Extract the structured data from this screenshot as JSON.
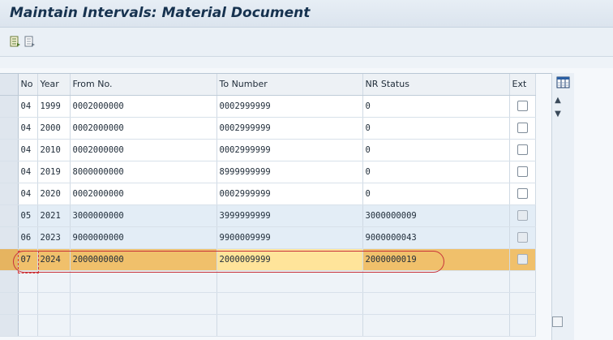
{
  "title": "Maintain Intervals: Material Document",
  "toolbar": {
    "buttons": [
      {
        "icon": "select-all-icon"
      },
      {
        "icon": "deselect-all-icon"
      }
    ]
  },
  "table": {
    "headers": {
      "no": "No",
      "year": "Year",
      "from": "From No.",
      "to": "To Number",
      "status": "NR Status",
      "ext": "Ext"
    },
    "rows": [
      {
        "no": "04",
        "year": "1999",
        "from": "0002000000",
        "to": "0002999999",
        "status": "0"
      },
      {
        "no": "04",
        "year": "2000",
        "from": "0002000000",
        "to": "0002999999",
        "status": "0"
      },
      {
        "no": "04",
        "year": "2010",
        "from": "0002000000",
        "to": "0002999999",
        "status": "0"
      },
      {
        "no": "04",
        "year": "2019",
        "from": "8000000000",
        "to": "8999999999",
        "status": "0"
      },
      {
        "no": "04",
        "year": "2020",
        "from": "0002000000",
        "to": "0002999999",
        "status": "0"
      },
      {
        "no": "05",
        "year": "2021",
        "from": "3000000000",
        "to": "3999999999",
        "status": "3000000009"
      },
      {
        "no": "06",
        "year": "2023",
        "from": "9000000000",
        "to": "9900009999",
        "status": "9000000043"
      },
      {
        "no": "07",
        "year": "2024",
        "from": "2000000000",
        "to": "2000009999",
        "status": "2000000019"
      }
    ]
  },
  "colors": {
    "highlight_row": "#f0c06b",
    "annotation": "#c8323a"
  }
}
